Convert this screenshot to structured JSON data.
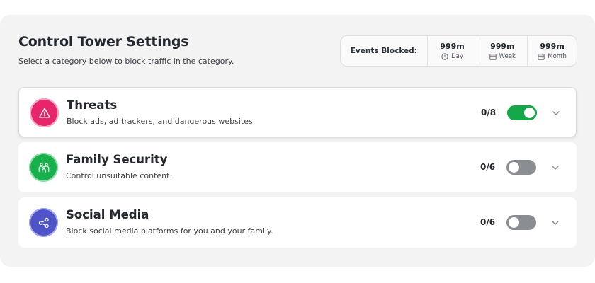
{
  "header": {
    "title": "Control Tower Settings",
    "subtitle": "Select a category below to block traffic in the category."
  },
  "stats": {
    "label": "Events Blocked:",
    "items": [
      {
        "value": "999m",
        "period": "Day",
        "icon": "clock-icon"
      },
      {
        "value": "999m",
        "period": "Week",
        "icon": "calendar-icon"
      },
      {
        "value": "999m",
        "period": "Month",
        "icon": "calendar-icon"
      }
    ]
  },
  "categories": [
    {
      "name": "Threats",
      "description": "Block ads, ad trackers, and dangerous websites.",
      "count": "0/8",
      "enabled": true,
      "icon": "warning-icon",
      "color": "#e8246a"
    },
    {
      "name": "Family Security",
      "description": "Control unsuitable content.",
      "count": "0/6",
      "enabled": false,
      "icon": "family-icon",
      "color": "#18b04a"
    },
    {
      "name": "Social Media",
      "description": "Block social media platforms for you and your family.",
      "count": "0/6",
      "enabled": false,
      "icon": "share-icon",
      "color": "#4f54c8"
    }
  ],
  "colors": {
    "toggle_on": "#14a84a",
    "toggle_off": "#8a8d92",
    "panel_bg": "#f3f3f3"
  }
}
